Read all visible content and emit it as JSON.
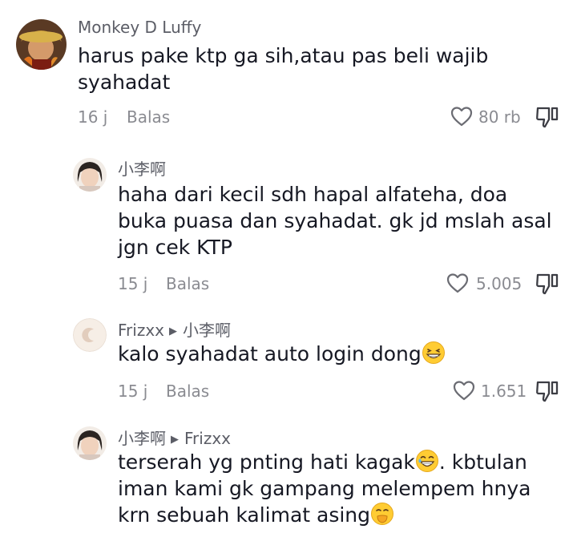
{
  "comments": [
    {
      "username": "Monkey D Luffy",
      "reply_to": "",
      "text": "harus pake ktp ga sih,atau pas beli wajib syahadat",
      "time": "16 j",
      "reply_label": "Balas",
      "likes": "80 rb"
    },
    {
      "username": "小李啊",
      "reply_to": "",
      "text": "haha dari kecil sdh hapal alfateha, doa buka puasa dan syahadat. gk jd mslah asal jgn cek KTP",
      "time": "15 j",
      "reply_label": "Balas",
      "likes": "5.005"
    },
    {
      "username": "Frizxx",
      "reply_to": "小李啊",
      "text": "kalo syahadat auto login dong",
      "time": "15 j",
      "reply_label": "Balas",
      "likes": "1.651"
    },
    {
      "username": "小李啊",
      "reply_to": "Frizxx",
      "text_lines": [
        "terserah yg pnting hati kagak",
        ". kbtulan",
        "iman kami gk gampang melempem hnya",
        "krn sebuah kalimat asing"
      ],
      "time": "",
      "reply_label": "",
      "likes": ""
    }
  ],
  "icons": {
    "heart": "heart-outline-icon",
    "dislike": "thumbs-down-icon",
    "reply_arrow": "triangle-right-icon",
    "emoji_grin": "grinning-squinting-face-emoji",
    "emoji_laugh": "laughing-face-emoji",
    "emoji_shush": "face-with-hand-over-mouth-emoji"
  },
  "colors": {
    "text": "#161823",
    "username": "#5b5d66",
    "meta": "#8a8b91"
  }
}
